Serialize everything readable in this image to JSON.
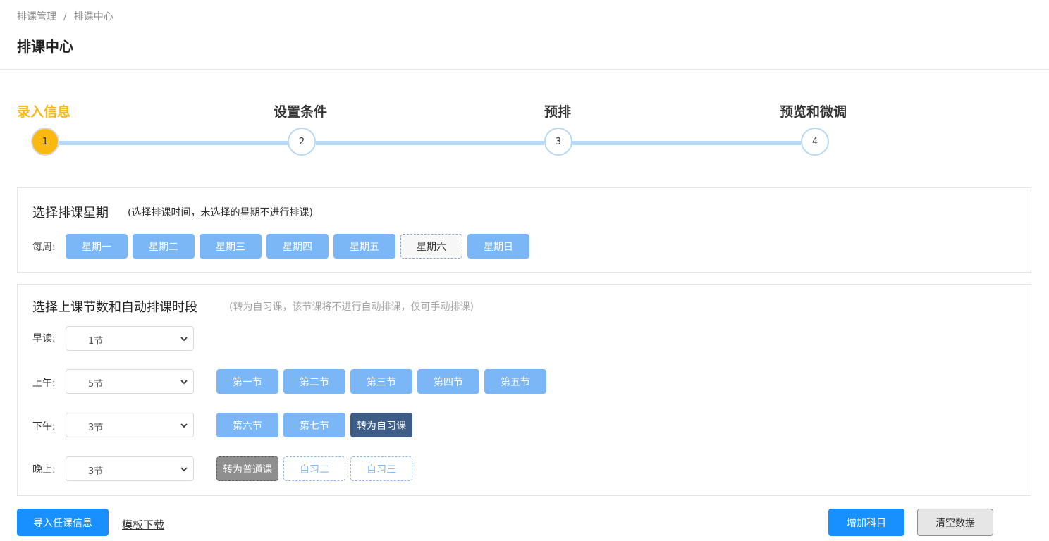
{
  "breadcrumb": {
    "parent": "排课管理",
    "separator": "/",
    "current": "排课中心"
  },
  "page_title": "排课中心",
  "steps": [
    {
      "label": "录入信息",
      "number": "1",
      "active": true
    },
    {
      "label": "设置条件",
      "number": "2",
      "active": false
    },
    {
      "label": "预排",
      "number": "3",
      "active": false
    },
    {
      "label": "预览和微调",
      "number": "4",
      "active": false
    }
  ],
  "weekday_panel": {
    "title": "选择排课星期",
    "hint": "(选择排课时间，未选择的星期不进行排课)",
    "row_label": "每周:",
    "days": [
      {
        "label": "星期一",
        "selected": true
      },
      {
        "label": "星期二",
        "selected": true
      },
      {
        "label": "星期三",
        "selected": true
      },
      {
        "label": "星期四",
        "selected": true
      },
      {
        "label": "星期五",
        "selected": true
      },
      {
        "label": "星期六",
        "selected": false
      },
      {
        "label": "星期日",
        "selected": true
      }
    ]
  },
  "periods_panel": {
    "title": "选择上课节数和自动排课时段",
    "hint": "(转为自习课，该节课将不进行自动排课，仅可手动排课)",
    "rows": [
      {
        "label": "早读:",
        "count": "1节",
        "buttons": []
      },
      {
        "label": "上午:",
        "count": "5节",
        "buttons": [
          "第一节",
          "第二节",
          "第三节",
          "第四节",
          "第五节"
        ]
      },
      {
        "label": "下午:",
        "count": "3节",
        "buttons": [
          "第六节",
          "第七节",
          "转为自习课"
        ]
      },
      {
        "label": "晚上:",
        "count": "3节",
        "buttons": [
          "转为普通课",
          "自习二",
          "自习三"
        ]
      }
    ]
  },
  "actions": {
    "import": "导入任课信息",
    "template": "模板下载",
    "add_subject": "增加科目",
    "clear": "清空数据"
  },
  "colors": {
    "accent": "#fab911",
    "step_line": "#b7d9f5",
    "day_button": "#7bb7f7",
    "self_study_button": "#3e5d86",
    "primary": "#1890ff"
  }
}
